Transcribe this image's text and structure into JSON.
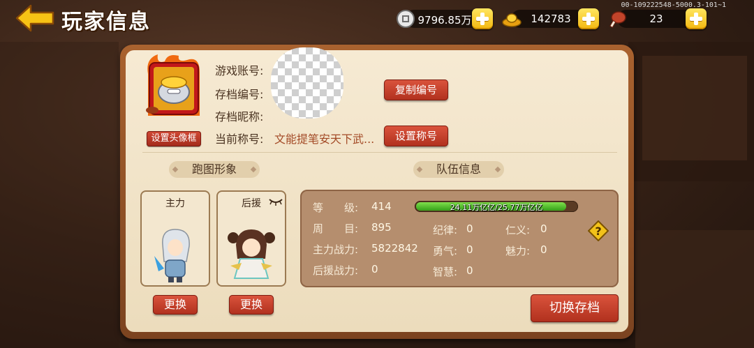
{
  "header": {
    "title": "玩家信息",
    "version": "00-109222548-5000.3-101~1"
  },
  "resources": [
    {
      "icon": "silver-coin-icon",
      "value": "9796.85万"
    },
    {
      "icon": "gold-ingot-icon",
      "value": "142783"
    },
    {
      "icon": "meat-stamina-icon",
      "value": "23"
    }
  ],
  "profile": {
    "set_frame_label": "设置头像框",
    "game_account_label": "游戏账号:",
    "save_id_label": "存档编号:",
    "save_nickname_label": "存档昵称:",
    "current_title_label": "当前称号:",
    "current_title_value": "文能提笔安天下武...",
    "copy_id_button": "复制编号",
    "set_title_button": "设置称号"
  },
  "sections": {
    "run_image": "跑图形象",
    "team_info": "队伍信息"
  },
  "characters": [
    {
      "label": "主力",
      "replace": "更换"
    },
    {
      "label": "后援",
      "replace": "更换"
    }
  ],
  "team": {
    "level_label": "等　　级:",
    "level_value": "414",
    "exp_text": "24.11万亿亿/25.77万亿亿",
    "exp_progress": 0.936,
    "round_label": "周　　目:",
    "round_value": "895",
    "main_power_label": "主力战力:",
    "main_power_value": "5822842",
    "support_power_label": "后援战力:",
    "support_power_value": "0",
    "discipline_label": "纪律:",
    "discipline_value": "0",
    "courage_label": "勇气:",
    "courage_value": "0",
    "wisdom_label": "智慧:",
    "wisdom_value": "0",
    "benevolence_label": "仁义:",
    "benevolence_value": "0",
    "charm_label": "魅力:",
    "charm_value": "0"
  },
  "switch_save_button": "切换存档"
}
